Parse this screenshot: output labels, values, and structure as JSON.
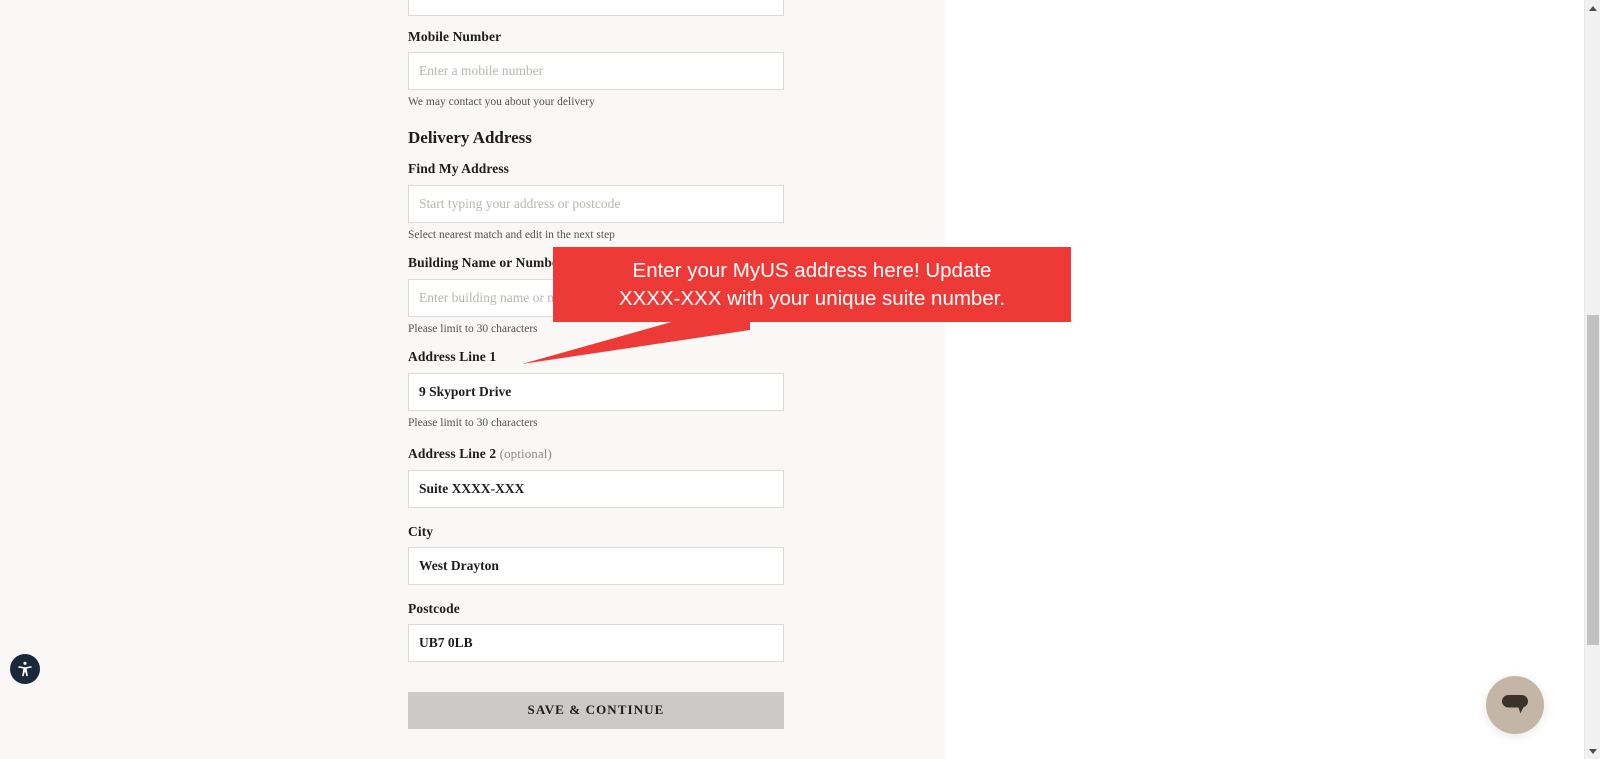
{
  "page": {
    "background_color": "#ffffff",
    "panel_color": "#f9f8f6"
  },
  "form": {
    "fields": [
      {
        "id": "mobile-number",
        "label": "Mobile Number",
        "value": "",
        "placeholder": "Enter a mobile number",
        "helper": "We may contact you about your delivery"
      },
      {
        "id": "find-my-address",
        "label": "Find My Address",
        "value": "",
        "placeholder": "Start typing your address or postcode",
        "helper": "Select nearest match and edit in the next step"
      },
      {
        "id": "building-name-or-number",
        "label": "Building Name or Number",
        "value": "",
        "placeholder": "Enter building name or number",
        "helper": "Please limit to 30 characters"
      },
      {
        "id": "address-line-1",
        "label": "Address Line 1",
        "value": "9 Skyport Drive",
        "placeholder": "",
        "helper": "Please limit to 30 characters"
      },
      {
        "id": "address-line-2",
        "label": "Address Line 2",
        "label_suffix": "(optional)",
        "value": "Suite XXXX-XXX",
        "placeholder": "",
        "helper": ""
      },
      {
        "id": "city",
        "label": "City",
        "value": "West Drayton",
        "placeholder": "",
        "helper": ""
      },
      {
        "id": "postcode",
        "label": "Postcode",
        "value": "UB7 0LB",
        "placeholder": "",
        "helper": ""
      }
    ],
    "section_heading": "Delivery Address",
    "submit_label": "SAVE & CONTINUE"
  },
  "annotation": {
    "text": "Enter your MyUS address here! Update\nXXXX-XXX with your unique suite number.",
    "background_color": "#ee3a36",
    "text_color": "#ffffff"
  },
  "widgets": {
    "accessibility_icon": "accessibility-person-icon",
    "chat_icon": "chat-bubble-icon",
    "accessibility_color": "#19293a",
    "chat_color": "#c3b6a7"
  },
  "scrollbar": {
    "up_icon": "chevron-up-icon",
    "down_icon": "chevron-down-icon",
    "thumb_color": "#c1c1c1",
    "track_color": "#f1f1f1"
  }
}
